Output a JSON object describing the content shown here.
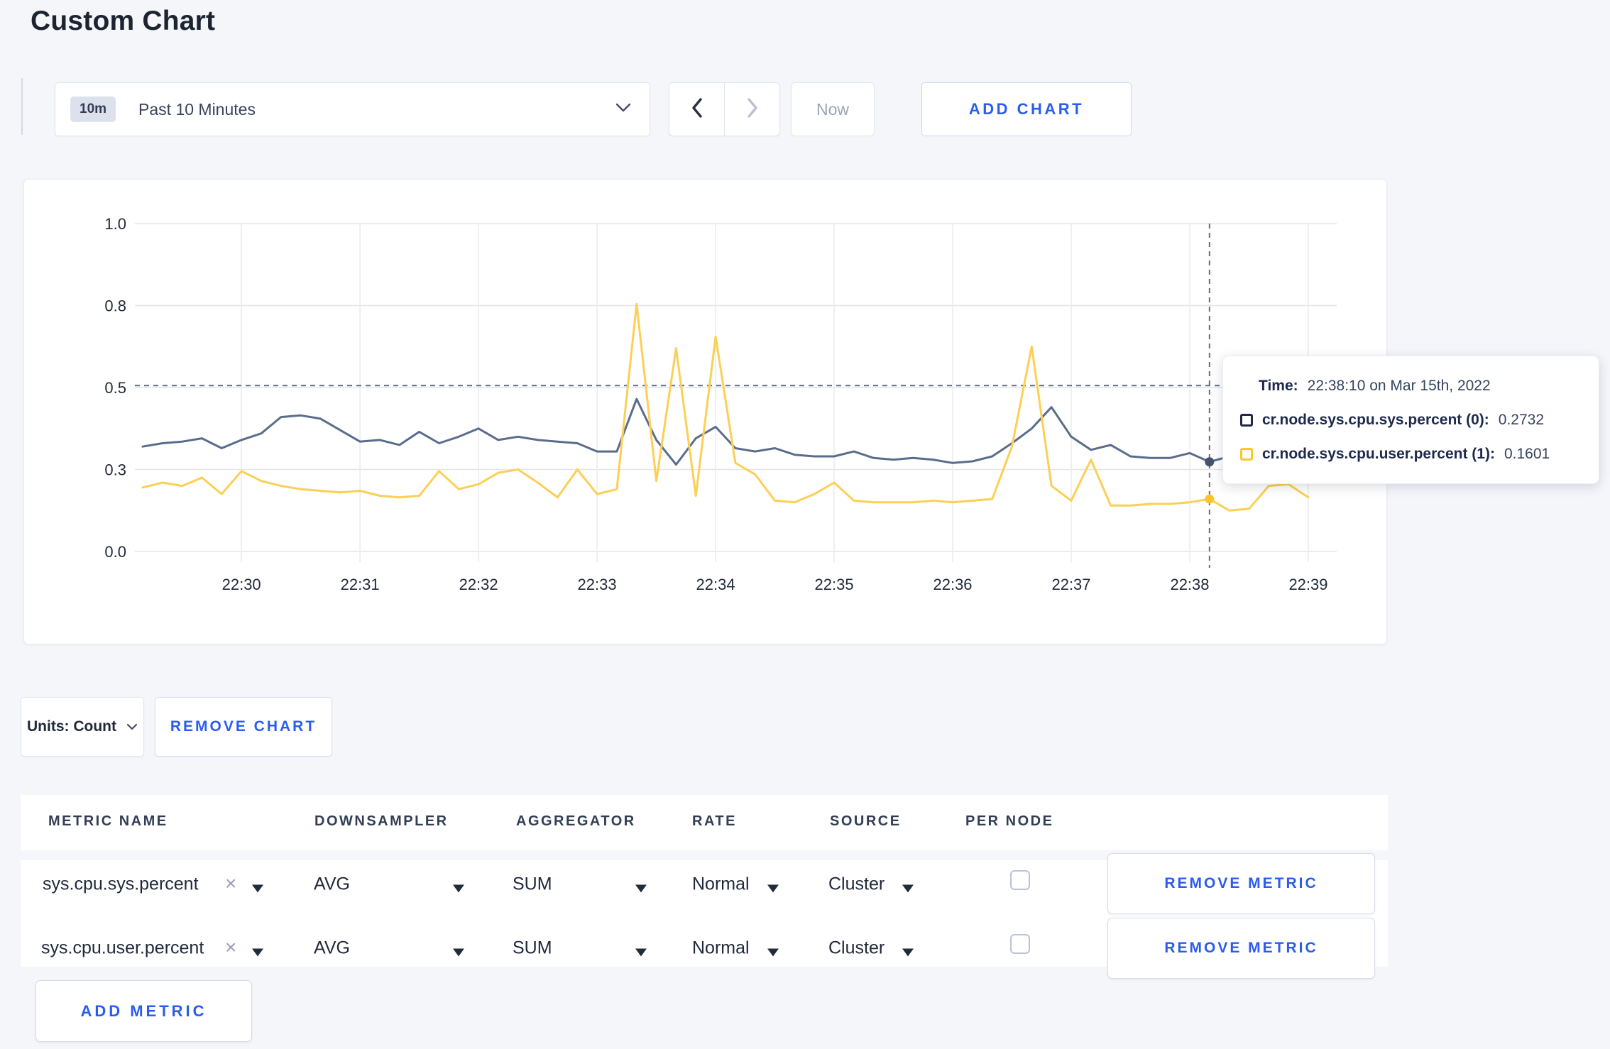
{
  "page": {
    "title": "Custom Chart"
  },
  "toolbar": {
    "time_window_badge": "10m",
    "time_window_label": "Past 10 Minutes",
    "now_label": "Now",
    "add_chart_label": "ADD CHART"
  },
  "chart": {
    "tooltip": {
      "time_label": "Time:",
      "time_value": "22:38:10 on Mar 15th, 2022",
      "series": [
        {
          "name": "cr.node.sys.cpu.sys.percent (0):",
          "value": "0.2732",
          "color": "#1f2a48"
        },
        {
          "name": "cr.node.sys.cpu.user.percent (1):",
          "value": "0.1601",
          "color": "#ffc529"
        }
      ]
    }
  },
  "chart_data": {
    "type": "line",
    "title": "",
    "xlabel": "",
    "ylabel": "",
    "ylim": [
      0,
      1
    ],
    "grid": true,
    "legend_position": "tooltip",
    "xticks": [
      "22:30",
      "22:31",
      "22:32",
      "22:33",
      "22:34",
      "22:35",
      "22:36",
      "22:37",
      "22:38",
      "22:39"
    ],
    "ytick_labels": [
      "0.0",
      "0.3",
      "0.5",
      "0.8",
      "1.0"
    ],
    "ytick_positions": [
      0,
      0.25,
      0.5,
      0.75,
      1.0
    ],
    "x": [
      "22:29:10",
      "22:29:20",
      "22:29:30",
      "22:29:40",
      "22:29:50",
      "22:30:00",
      "22:30:10",
      "22:30:20",
      "22:30:30",
      "22:30:40",
      "22:30:50",
      "22:31:00",
      "22:31:10",
      "22:31:20",
      "22:31:30",
      "22:31:40",
      "22:31:50",
      "22:32:00",
      "22:32:10",
      "22:32:20",
      "22:32:30",
      "22:32:40",
      "22:32:50",
      "22:33:00",
      "22:33:10",
      "22:33:20",
      "22:33:30",
      "22:33:40",
      "22:33:50",
      "22:34:00",
      "22:34:10",
      "22:34:20",
      "22:34:30",
      "22:34:40",
      "22:34:50",
      "22:35:00",
      "22:35:10",
      "22:35:20",
      "22:35:30",
      "22:35:40",
      "22:35:50",
      "22:36:00",
      "22:36:10",
      "22:36:20",
      "22:36:30",
      "22:36:40",
      "22:36:50",
      "22:37:00",
      "22:37:10",
      "22:37:20",
      "22:37:30",
      "22:37:40",
      "22:37:50",
      "22:38:00",
      "22:38:10",
      "22:38:20",
      "22:38:30",
      "22:38:40",
      "22:38:50",
      "22:39:00"
    ],
    "series": [
      {
        "name": "cr.node.sys.cpu.sys.percent",
        "color": "#5a6c8c",
        "values": [
          0.32,
          0.33,
          0.335,
          0.345,
          0.315,
          0.34,
          0.36,
          0.41,
          0.415,
          0.405,
          0.37,
          0.335,
          0.34,
          0.325,
          0.365,
          0.33,
          0.35,
          0.375,
          0.34,
          0.35,
          0.34,
          0.335,
          0.33,
          0.305,
          0.305,
          0.465,
          0.34,
          0.265,
          0.345,
          0.38,
          0.315,
          0.305,
          0.315,
          0.295,
          0.29,
          0.29,
          0.305,
          0.285,
          0.28,
          0.285,
          0.28,
          0.27,
          0.275,
          0.29,
          0.33,
          0.375,
          0.44,
          0.35,
          0.31,
          0.325,
          0.29,
          0.285,
          0.285,
          0.3,
          0.2732,
          0.29,
          0.285,
          0.28,
          0.29,
          0.3
        ]
      },
      {
        "name": "cr.node.sys.cpu.user.percent",
        "color": "#fccf55",
        "values": [
          0.195,
          0.21,
          0.2,
          0.225,
          0.175,
          0.245,
          0.215,
          0.2,
          0.19,
          0.185,
          0.18,
          0.185,
          0.17,
          0.165,
          0.17,
          0.245,
          0.19,
          0.205,
          0.24,
          0.25,
          0.21,
          0.165,
          0.25,
          0.175,
          0.19,
          0.755,
          0.215,
          0.62,
          0.17,
          0.655,
          0.27,
          0.235,
          0.155,
          0.15,
          0.175,
          0.21,
          0.155,
          0.15,
          0.15,
          0.15,
          0.155,
          0.15,
          0.155,
          0.16,
          0.32,
          0.625,
          0.2,
          0.155,
          0.28,
          0.14,
          0.14,
          0.145,
          0.145,
          0.15,
          0.1601,
          0.125,
          0.13,
          0.2,
          0.205,
          0.165
        ]
      }
    ],
    "crosshair": {
      "time": "22:38:10",
      "index": 54,
      "hline_value": 0.506,
      "dot_colors": [
        "#44536e",
        "#fcc52c"
      ]
    }
  },
  "units_row": {
    "units_label": "Units: Count",
    "remove_chart_label": "REMOVE CHART"
  },
  "table": {
    "headers": [
      "METRIC NAME",
      "DOWNSAMPLER",
      "AGGREGATOR",
      "RATE",
      "SOURCE",
      "PER NODE"
    ],
    "remove_metric_label": "REMOVE METRIC",
    "add_metric_label": "ADD METRIC",
    "metrics": [
      {
        "name": "sys.cpu.sys.percent",
        "downsampler": "AVG",
        "aggregator": "SUM",
        "rate": "Normal",
        "source": "Cluster",
        "per_node_checked": false
      },
      {
        "name": "sys.cpu.user.percent",
        "downsampler": "AVG",
        "aggregator": "SUM",
        "rate": "Normal",
        "source": "Cluster",
        "per_node_checked": false
      }
    ]
  }
}
